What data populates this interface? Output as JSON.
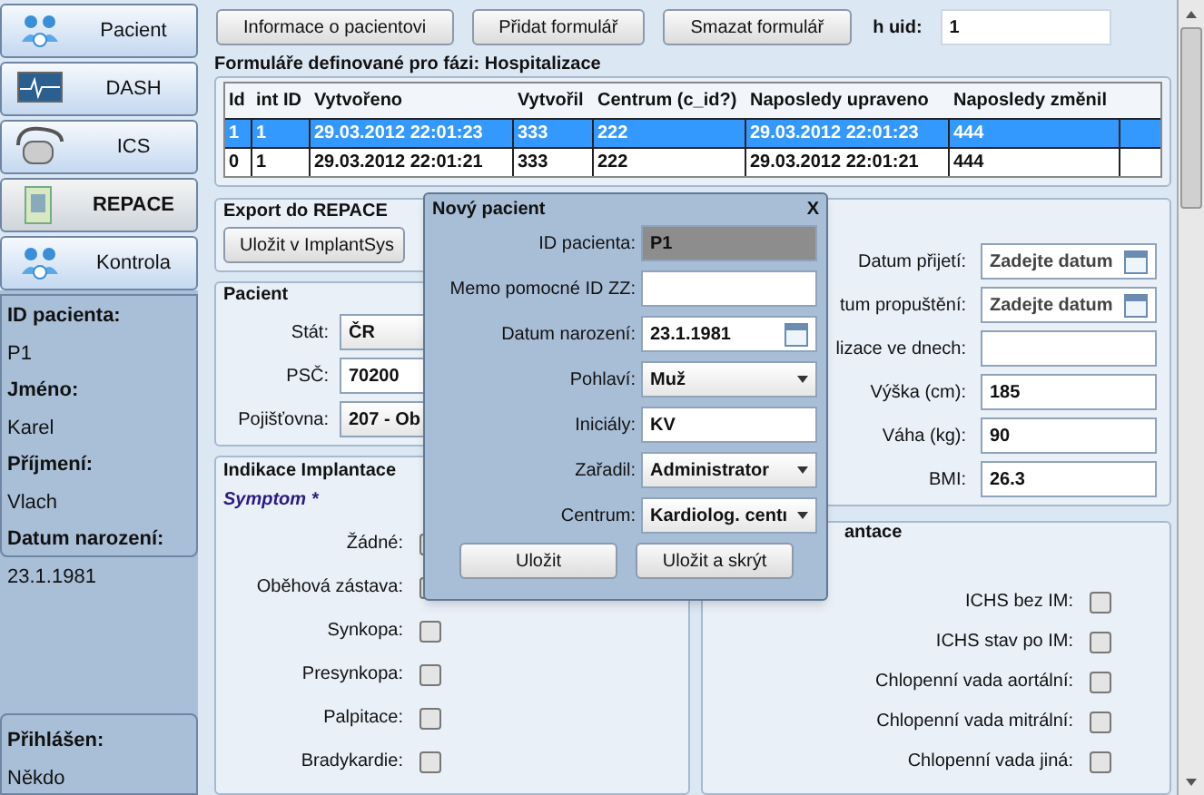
{
  "sidebar": {
    "nav": [
      {
        "label": "Pacient",
        "kind": "people",
        "selected": false
      },
      {
        "label": "DASH",
        "kind": "monitor",
        "selected": false
      },
      {
        "label": "ICS",
        "kind": "device",
        "selected": false
      },
      {
        "label": "REPACE",
        "kind": "document",
        "selected": true
      },
      {
        "label": "Kontrola",
        "kind": "people",
        "selected": false
      }
    ],
    "patient_info": [
      {
        "label": "ID pacienta:",
        "value": "P1"
      },
      {
        "label": "Jméno:",
        "value": "Karel"
      },
      {
        "label": "Příjmení:",
        "value": "Vlach"
      },
      {
        "label": "Datum narození:",
        "value": "23.1.1981"
      }
    ],
    "logged_in": {
      "label": "Přihlášen:",
      "value": "Někdo"
    }
  },
  "toolbar": {
    "buttons": [
      "Informace o pacientovi",
      "Přidat formulář",
      "Smazat formulář"
    ],
    "h_uid": {
      "label": "h uid:",
      "value": "1"
    }
  },
  "forms_table": {
    "title": "Formuláře definované pro fázi: Hospitalizace",
    "columns": [
      "Id",
      "int ID",
      "Vytvořeno",
      "Vytvořil",
      "Centrum (c_id?)",
      "Naposledy upraveno",
      "Naposledy změnil"
    ],
    "rows": [
      {
        "selected": true,
        "cells": [
          "1",
          "1",
          "29.03.2012 22:01:23",
          "333",
          "222",
          "29.03.2012 22:01:23",
          "444"
        ]
      },
      {
        "selected": false,
        "cells": [
          "0",
          "1",
          "29.03.2012 22:01:21",
          "333",
          "222",
          "29.03.2012 22:01:21",
          "444"
        ]
      }
    ]
  },
  "export": {
    "legend": "Export do REPACE",
    "button": "Uložit v ImplantSys"
  },
  "patient": {
    "legend": "Pacient",
    "fields": [
      {
        "label": "Stát:",
        "value": "ČR",
        "kind": "select"
      },
      {
        "label": "PSČ:",
        "value": "70200",
        "kind": "input"
      },
      {
        "label": "Pojišťovna:",
        "value": "207 - Ob",
        "kind": "select"
      }
    ]
  },
  "hospital": {
    "fields": [
      {
        "label": "Datum přijetí:",
        "placeholder": "Zadejte datum",
        "kind": "date"
      },
      {
        "label": "tum propuštění:",
        "placeholder": "Zadejte datum",
        "kind": "date"
      },
      {
        "label": "lizace ve dnech:",
        "kind": "input"
      },
      {
        "label": "Výška (cm):",
        "value": "185",
        "kind": "input"
      },
      {
        "label": "Váha (kg):",
        "value": "90",
        "kind": "input"
      },
      {
        "label": "BMI:",
        "value": "26.3",
        "kind": "input"
      }
    ]
  },
  "indikace": {
    "legend": "Indikace Implantace",
    "subheading": "Symptom *",
    "items": [
      {
        "label": "Žádné:",
        "checked": false
      },
      {
        "label": "Oběhová zástava:",
        "checked": false
      },
      {
        "label": "Synkopa:",
        "checked": false
      },
      {
        "label": "Presynkopa:",
        "checked": false
      },
      {
        "label": "Palpitace:",
        "checked": false
      },
      {
        "label": "Bradykardie:",
        "checked": false
      }
    ]
  },
  "etiology": {
    "legend": "antace",
    "items": [
      {
        "label": "ICHS bez IM:",
        "checked": false
      },
      {
        "label": "ICHS stav po IM:",
        "checked": false
      },
      {
        "label": "Chlopenní vada aortální:",
        "checked": false
      },
      {
        "label": "Chlopenní vada mitrální:",
        "checked": false
      },
      {
        "label": "Chlopenní vada jiná:",
        "checked": false
      }
    ]
  },
  "dialog": {
    "title": "Nový pacient",
    "close": "X",
    "fields": [
      {
        "label": "ID pacienta:",
        "value": "P1",
        "kind": "readonly"
      },
      {
        "label": "Memo pomocné ID ZZ:",
        "kind": "input"
      },
      {
        "label": "Datum narození:",
        "value": "23.1.1981",
        "kind": "date"
      },
      {
        "label": "Pohlaví:",
        "value": "Muž",
        "kind": "select"
      },
      {
        "label": "Iniciály:",
        "value": "KV",
        "kind": "input"
      },
      {
        "label": "Zařadil:",
        "value": "Administrator",
        "kind": "select"
      },
      {
        "label": "Centrum:",
        "value": "Kardiolog. centı",
        "kind": "select"
      }
    ],
    "buttons": [
      "Uložit",
      "Uložit a skrýt"
    ]
  }
}
